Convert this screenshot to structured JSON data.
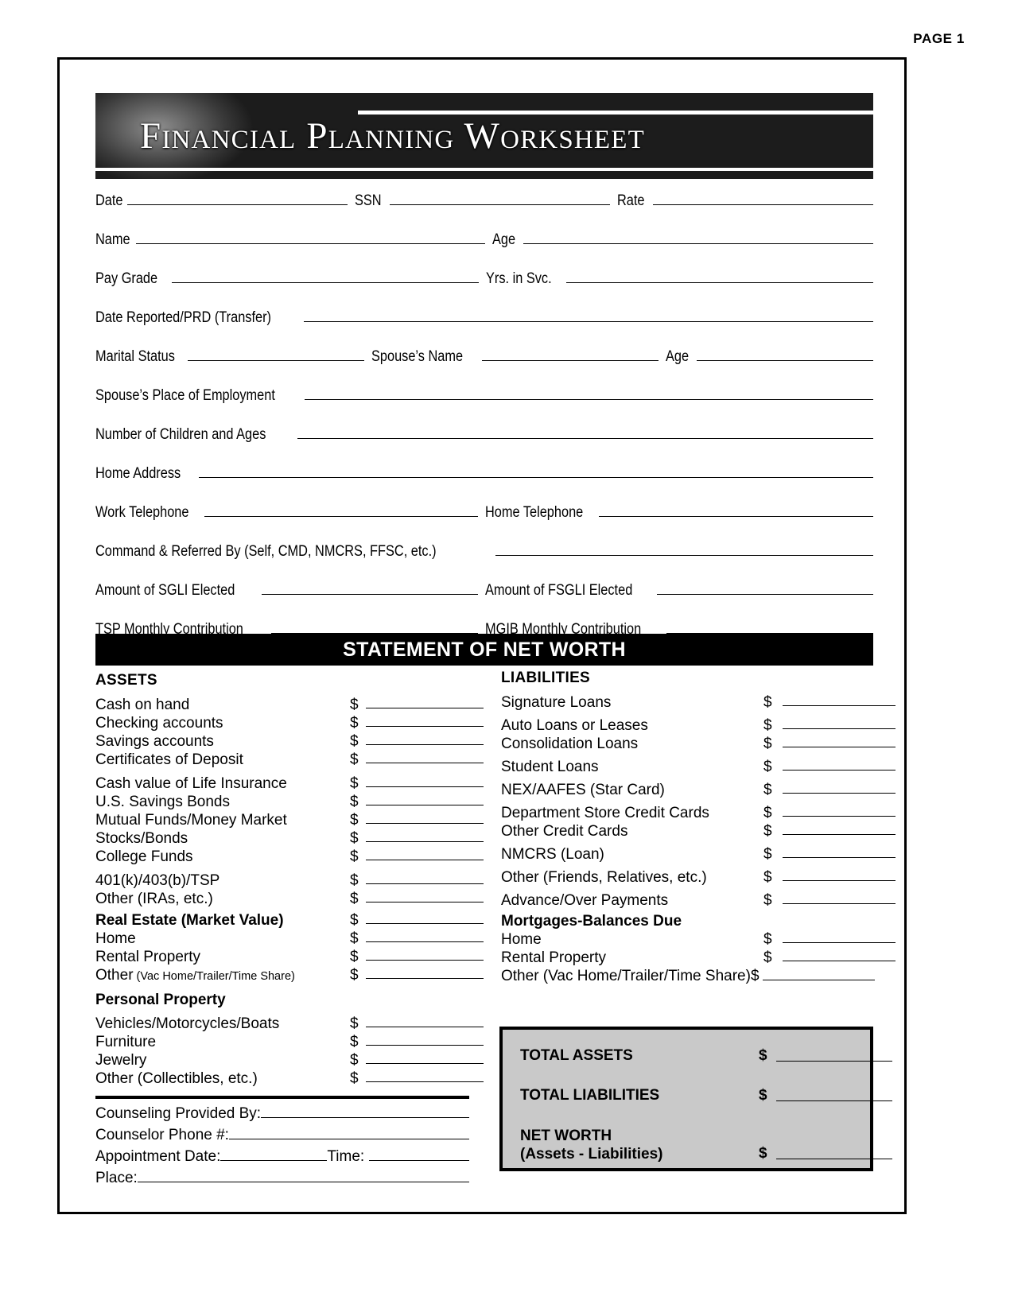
{
  "page_label": "PAGE 1",
  "banner": {
    "title": "Financial Planning Worksheet"
  },
  "info_rows": [
    {
      "fields": [
        {
          "label": "Date",
          "size": "sm",
          "spaced": false
        },
        {
          "label": "SSN",
          "size": "sm",
          "spaced": true
        },
        {
          "label": "Rate",
          "size": "sm",
          "spaced": true
        }
      ]
    },
    {
      "fields": [
        {
          "label": "Name",
          "size": "md",
          "spaced": false
        },
        {
          "label": "Age",
          "size": "md",
          "spaced": true
        }
      ]
    },
    {
      "fields": [
        {
          "label": "Pay Grade",
          "size": "md",
          "spaced": true
        },
        {
          "label": "Yrs. in Svc.",
          "size": "md",
          "spaced": true
        }
      ]
    },
    {
      "fields": [
        {
          "label": "Date Reported/PRD (Transfer)",
          "size": "lg",
          "spaced": true
        }
      ]
    },
    {
      "fields": [
        {
          "label": "Marital Status",
          "size": "sm",
          "spaced": false
        },
        {
          "label": "Spouse’s Name",
          "size": "sm",
          "spaced": true
        },
        {
          "label": "Age",
          "size": "sm",
          "spaced": true
        }
      ]
    },
    {
      "fields": [
        {
          "label": "Spouse’s Place of Employment",
          "size": "lg",
          "spaced": false
        }
      ]
    },
    {
      "fields": [
        {
          "label": "Number of Children and Ages",
          "size": "lg",
          "spaced": true
        }
      ]
    },
    {
      "fields": [
        {
          "label": "Home Address",
          "size": "lg",
          "spaced": true
        }
      ]
    },
    {
      "fields": [
        {
          "label": "Work Telephone",
          "size": "md",
          "spaced": false
        },
        {
          "label": "Home Telephone",
          "size": "md",
          "spaced": false
        }
      ]
    },
    {
      "fields": [
        {
          "label": "Command & Referred By (Self, CMD, NMCRS, FFSC, etc.)",
          "size": "lg",
          "spaced": true
        }
      ]
    },
    {
      "fields": [
        {
          "label": "Amount of SGLI Elected",
          "size": "md",
          "spaced": true
        },
        {
          "label": "Amount of FSGLI Elected",
          "size": "md",
          "spaced": false
        }
      ]
    },
    {
      "fields": [
        {
          "label": "TSP Monthly Contribution",
          "size": "md",
          "spaced": true
        },
        {
          "label": "MGIB Monthly Contribution",
          "size": "md",
          "spaced": false
        }
      ]
    }
  ],
  "net_worth_bar": "STATEMENT OF NET WORTH",
  "assets": {
    "heading": "ASSETS",
    "currency_symbol": "$",
    "items": [
      {
        "label": "Cash on hand",
        "amount": "",
        "type": "item",
        "gap": 0
      },
      {
        "label": "Checking accounts",
        "amount": "",
        "type": "item",
        "gap": 0
      },
      {
        "label": "Savings accounts",
        "amount": "",
        "type": "item",
        "gap": 0
      },
      {
        "label": "Certificates of Deposit",
        "amount": "",
        "type": "item",
        "gap": 7
      },
      {
        "label": "Cash value of Life Insurance",
        "amount": "",
        "type": "item",
        "gap": 0
      },
      {
        "label": "U.S. Savings Bonds",
        "amount": "",
        "type": "item",
        "gap": 0
      },
      {
        "label": "Mutual Funds/Money Market",
        "amount": "",
        "type": "item",
        "gap": 0
      },
      {
        "label": "Stocks/Bonds",
        "amount": "",
        "type": "item",
        "gap": 0
      },
      {
        "label": "College Funds",
        "amount": "",
        "type": "item",
        "gap": 7
      },
      {
        "label": "401(k)/403(b)/TSP",
        "amount": "",
        "type": "item",
        "gap": 0
      },
      {
        "label": "Other (IRAs, etc.)",
        "amount": "",
        "type": "item",
        "gap": 4
      },
      {
        "label": "Real Estate (Market Value)",
        "amount": "",
        "type": "bold-item",
        "gap": 0
      },
      {
        "label": "Home",
        "amount": "",
        "type": "item",
        "gap": 0
      },
      {
        "label": "Rental Property",
        "amount": "",
        "type": "item",
        "gap": 0
      },
      {
        "label": "Other",
        "sublabel": "(Vac Home/Trailer/Time Share)",
        "amount": "",
        "type": "item-sub",
        "gap": 7
      },
      {
        "label": "Personal Property",
        "type": "bold-head",
        "gap": 7
      },
      {
        "label": "Vehicles/Motorcycles/Boats",
        "amount": "",
        "type": "item",
        "gap": 0
      },
      {
        "label": "Furniture",
        "amount": "",
        "type": "item",
        "gap": 0
      },
      {
        "label": "Jewelry",
        "amount": "",
        "type": "item",
        "gap": 0
      },
      {
        "label": "Other (Collectibles, etc.)",
        "amount": "",
        "type": "item",
        "gap": 0
      }
    ]
  },
  "liabilities": {
    "heading": "LIABILITIES",
    "currency_symbol": "$",
    "items": [
      {
        "label": "Signature Loans",
        "amount": "",
        "type": "item",
        "gap": 6
      },
      {
        "label": "Auto Loans or Leases",
        "amount": "",
        "type": "item",
        "gap": 0
      },
      {
        "label": "Consolidation Loans",
        "amount": "",
        "type": "item",
        "gap": 6
      },
      {
        "label": "Student Loans",
        "amount": "",
        "type": "item",
        "gap": 6
      },
      {
        "label": "NEX/AAFES (Star Card)",
        "amount": "",
        "type": "item",
        "gap": 6
      },
      {
        "label": "Department Store Credit Cards",
        "amount": "",
        "type": "item",
        "gap": 0
      },
      {
        "label": "Other Credit Cards",
        "amount": "",
        "type": "item",
        "gap": 6
      },
      {
        "label": "NMCRS (Loan)",
        "amount": "",
        "type": "item",
        "gap": 6
      },
      {
        "label": "Other (Friends, Relatives, etc.)",
        "amount": "",
        "type": "item",
        "gap": 6
      },
      {
        "label": "Advance/Over Payments",
        "amount": "",
        "type": "item",
        "gap": 4
      },
      {
        "label": "Mortgages-Balances Due",
        "type": "bold-head",
        "gap": 0
      },
      {
        "label": "Home",
        "amount": "",
        "type": "item",
        "gap": 0
      },
      {
        "label": "Rental Property",
        "amount": "",
        "type": "item",
        "gap": 0
      },
      {
        "label": "Other (Vac Home/Trailer/Time Share)",
        "amount": "",
        "type": "item-wide",
        "gap": 0
      }
    ]
  },
  "counseling": [
    {
      "label": "Counseling Provided By:",
      "value": ""
    },
    {
      "label": "Counselor Phone #:",
      "value": ""
    },
    {
      "label": "Appointment Date:",
      "value": "",
      "label2": "Time:",
      "value2": ""
    },
    {
      "label": "Place:",
      "value": ""
    }
  ],
  "totals": {
    "currency_symbol": "$",
    "rows": [
      {
        "label": "TOTAL ASSETS",
        "amount": ""
      },
      {
        "label": "TOTAL LIABILITIES",
        "amount": ""
      }
    ],
    "net_worth": {
      "label": "NET WORTH",
      "sublabel": "(Assets - Liabilities)",
      "amount": ""
    }
  }
}
